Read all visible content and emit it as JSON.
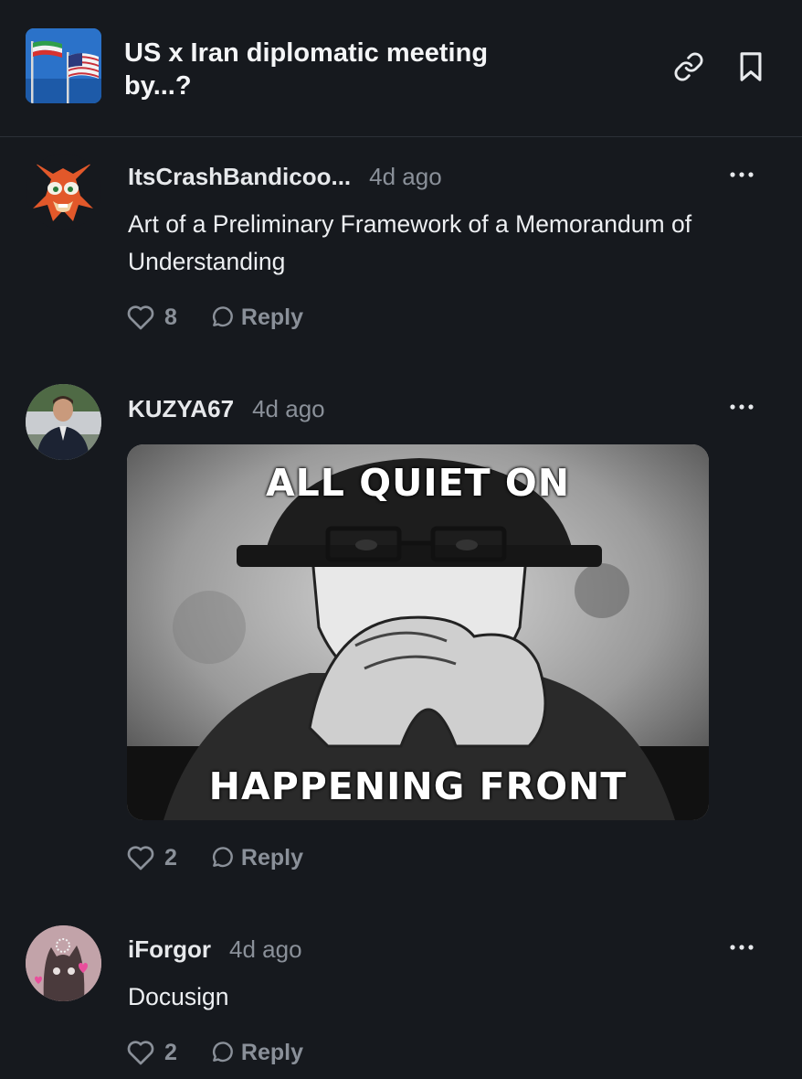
{
  "header": {
    "title": "US x Iran diplomatic meeting by...?",
    "thumb_icon": "us-iran-flags-thumbnail",
    "link_icon": "link-icon",
    "bookmark_icon": "bookmark-icon"
  },
  "comments": [
    {
      "username": "ItsCrashBandicoo...",
      "time": "4d ago",
      "text": "Art of a Preliminary Framework of a Memorandum of Understanding",
      "likes": "8",
      "reply_label": "Reply"
    },
    {
      "username": "KUZYA67",
      "time": "4d ago",
      "image": {
        "caption_top": "ALL QUIET ON",
        "caption_bottom": "HAPPENING FRONT"
      },
      "likes": "2",
      "reply_label": "Reply"
    },
    {
      "username": "iForgor",
      "time": "4d ago",
      "text": "Docusign",
      "likes": "2",
      "reply_label": "Reply"
    }
  ],
  "colors": {
    "background": "#16191e",
    "muted": "#8a9099",
    "text": "#edeff2",
    "divider": "#2c3037"
  }
}
